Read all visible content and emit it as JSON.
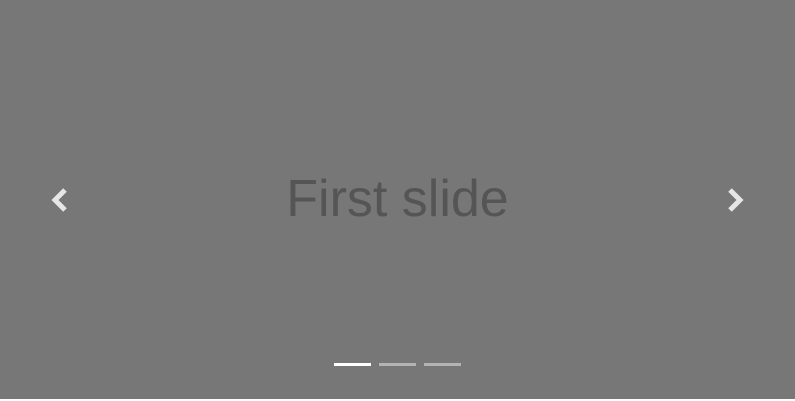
{
  "carousel": {
    "background": "#777777",
    "caption_color": "#555555",
    "active_index": 0,
    "slides": [
      {
        "caption": "First slide"
      }
    ],
    "indicators_count": 3,
    "controls": {
      "prev_icon": "chevron-left-icon",
      "next_icon": "chevron-right-icon"
    }
  }
}
